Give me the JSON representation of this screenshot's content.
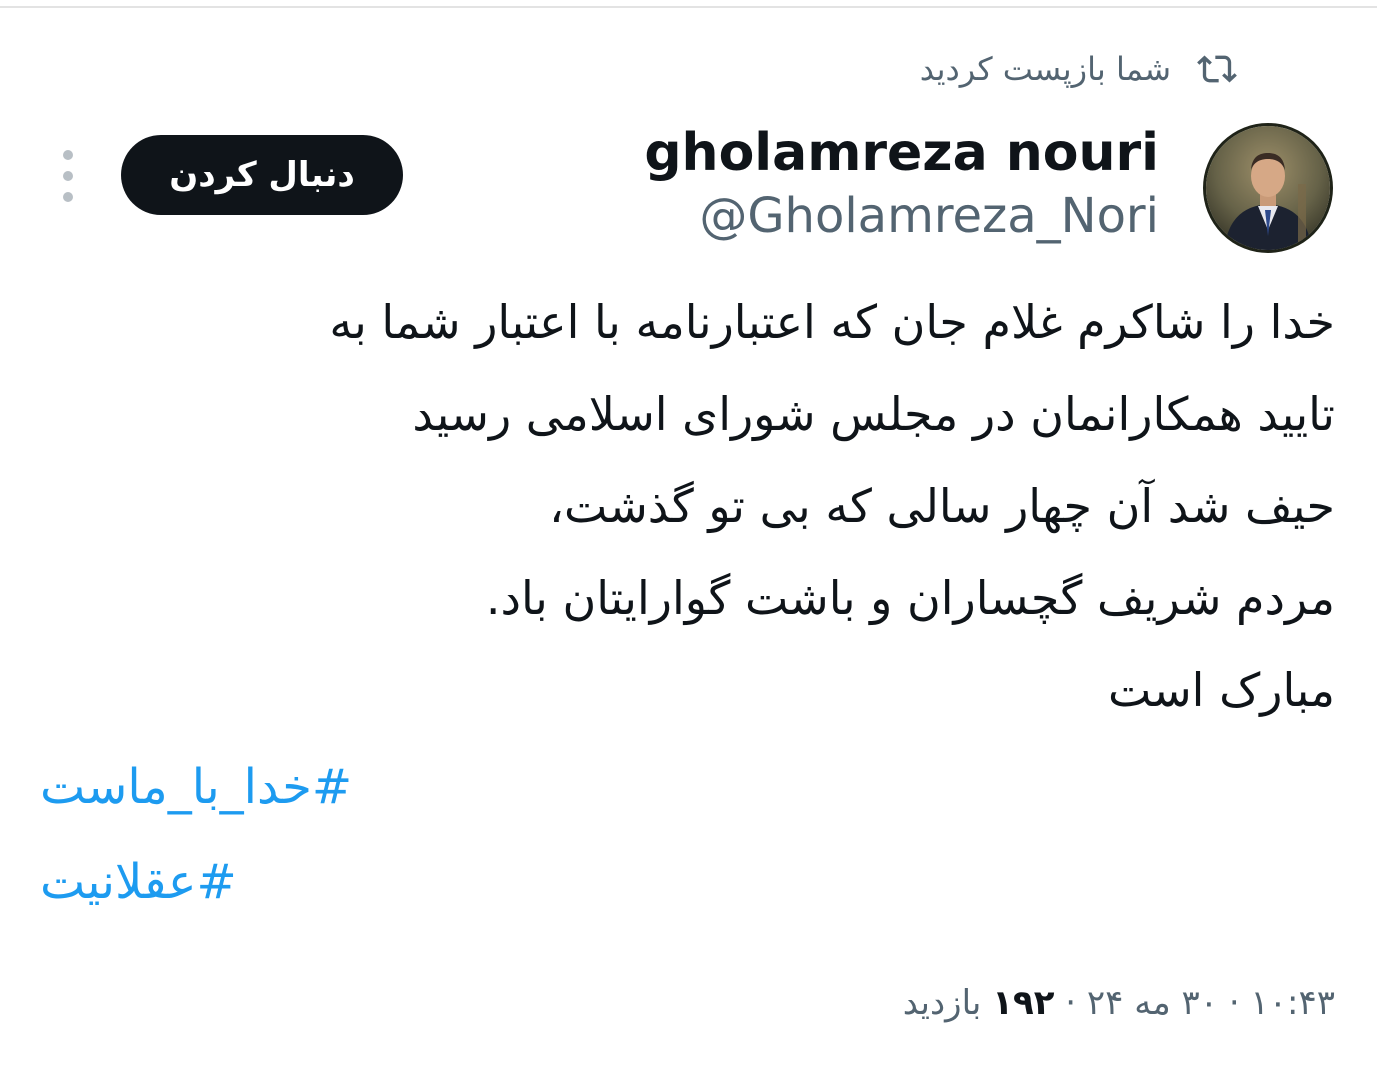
{
  "repost_banner": {
    "text": "شما بازپست کردید",
    "icon": "repost-icon"
  },
  "author": {
    "display_name": "gholamreza nouri",
    "handle": "@Gholamreza_Nori",
    "avatar": "profile-photo"
  },
  "actions": {
    "follow_label": "دنبال کردن",
    "more_icon": "more-vertical-icon"
  },
  "tweet": {
    "lines": [
      "خدا را شاکرم غلام جان که اعتبارنامه با اعتبار شما به",
      "تایید همکارانمان در مجلس شورای اسلامی رسید",
      "حیف شد آن چهار سالی که بی تو گذشت،",
      "مردم شریف گچساران و باشت گوارایتان باد.",
      "مبارک است"
    ],
    "hashtags": [
      "#خدا_با_ماست",
      "#عقلانیت"
    ]
  },
  "meta": {
    "time": "۱۰:۴۳",
    "separator": "·",
    "date": "۳۰ مه ۲۴",
    "views_count": "۱۹۲",
    "views_label": "بازدید"
  },
  "colors": {
    "text": "#0f1419",
    "secondary": "#536471",
    "link": "#1d9bf0",
    "button_bg": "#0f1419"
  }
}
